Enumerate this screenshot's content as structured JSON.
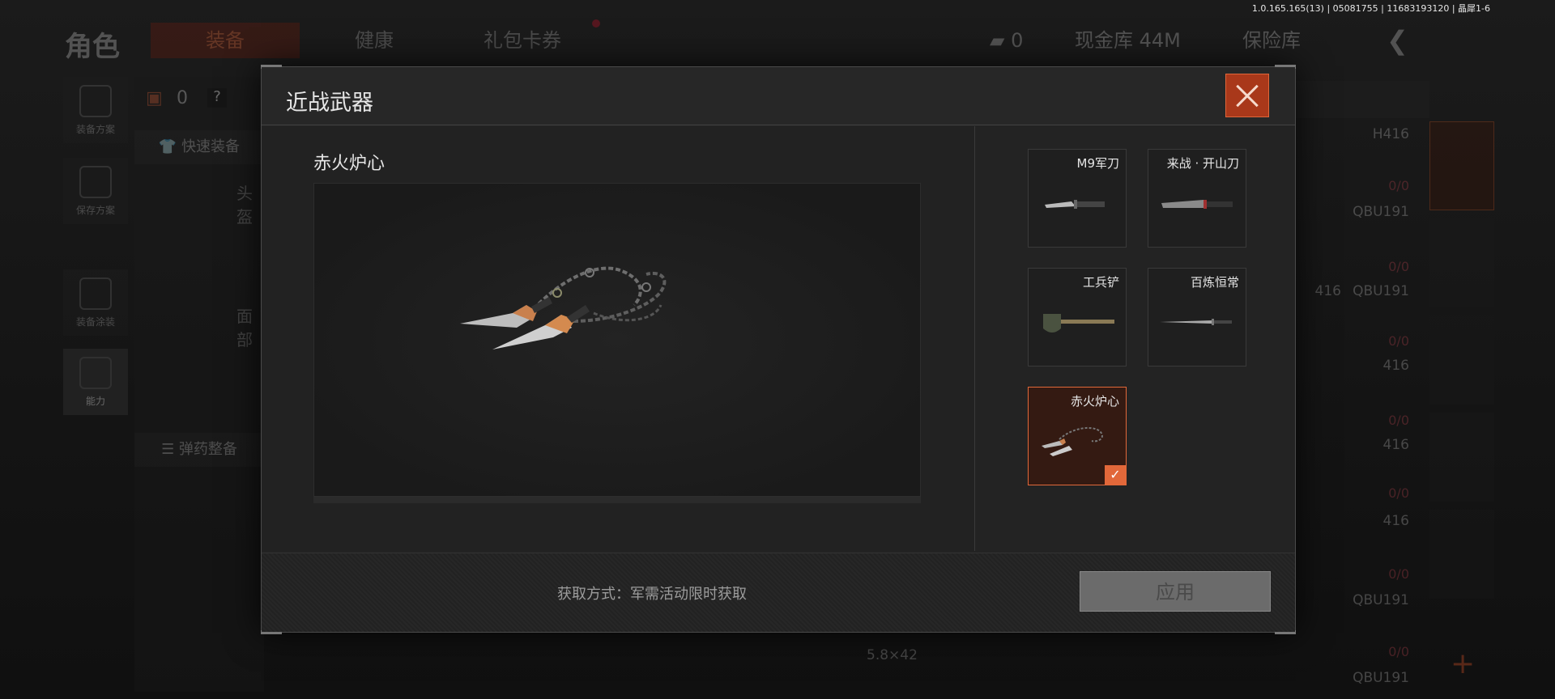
{
  "version_info": "1.0.165.165(13) | 05081755 | 11683193120 | 晶犀1-6",
  "background": {
    "title": "角色",
    "tabs": [
      "装备",
      "健康",
      "礼包卡券"
    ],
    "currency_count": "0",
    "cash_vault": "现金库 44M",
    "safe_vault": "保险库",
    "nav": [
      "装备方案",
      "保存方案",
      "装备涂装",
      "能力"
    ],
    "armor_count": "0",
    "quick_equip": "快速装备",
    "ammo_equip": "弹药整备",
    "slot_labels": [
      "头盔",
      "面部"
    ],
    "right_list": [
      "H416",
      "0/0",
      "QBU191",
      "0/0",
      "416",
      "QBU191",
      "0/0",
      "416",
      "0/0",
      "416",
      "0/0",
      "416",
      "0/0",
      "QBU191",
      "0/0",
      "QBU191"
    ],
    "bottom_ammo": "5.8×42"
  },
  "modal": {
    "title": "近战武器",
    "selected_name": "赤火炉心",
    "weapons": [
      {
        "label": "M9军刀",
        "icon": "knife-icon"
      },
      {
        "label": "来战 · 开山刀",
        "icon": "machete-icon"
      },
      {
        "label": "工兵铲",
        "icon": "shovel-icon"
      },
      {
        "label": "百炼恒常",
        "icon": "sword-icon"
      },
      {
        "label": "赤火炉心",
        "icon": "chain-blade-icon",
        "selected": true
      }
    ],
    "acquire_text": "获取方式：军需活动限时获取",
    "apply_label": "应用",
    "check_mark": "✓"
  },
  "colors": {
    "accent": "#e2683a",
    "close_bg": "#a9381a",
    "apply_bg": "#6b6b6b"
  }
}
